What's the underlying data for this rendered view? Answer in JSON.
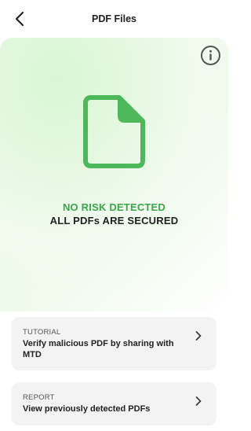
{
  "header": {
    "title": "PDF Files",
    "back_icon": "chevron-left-icon"
  },
  "hero": {
    "info_icon": "info-circle-icon",
    "document_icon": "document-icon",
    "status_primary": "NO RISK DETECTED",
    "status_secondary": "ALL PDFs ARE SECURED",
    "colors": {
      "accent_green": "#3aa84a",
      "icon_green": "#4cb85a",
      "background_tint": "#e6f8e2"
    }
  },
  "cards": {
    "tutorial": {
      "eyebrow": "TUTORIAL",
      "text": "Verify malicious PDF by sharing with MTD",
      "chevron_icon": "chevron-right-icon"
    },
    "report": {
      "eyebrow": "REPORT",
      "text": "View previously detected PDFs",
      "chevron_icon": "chevron-right-icon"
    }
  }
}
